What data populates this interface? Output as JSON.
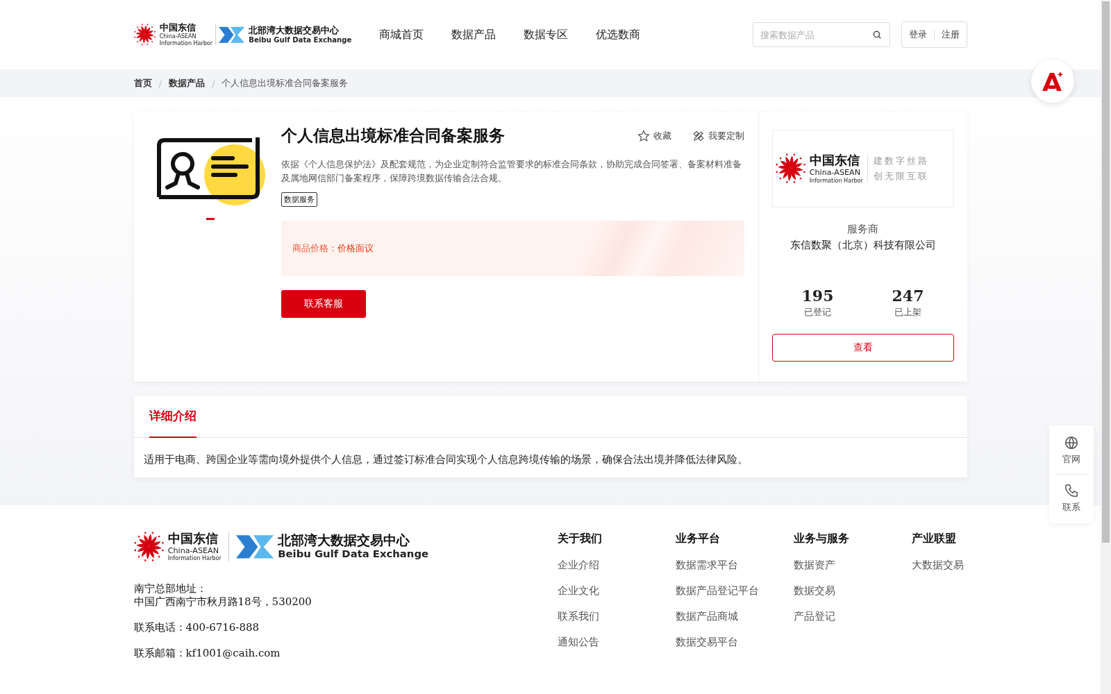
{
  "header": {
    "logo_cn": {
      "name": "中国东信",
      "en1": "China-ASEAN",
      "en2": "Information Harbor"
    },
    "logo_bb": {
      "name": "北部湾大数据交易中心",
      "en": "Beibu Gulf Data Exchange"
    },
    "nav": [
      {
        "label": "商城首页",
        "selected": false
      },
      {
        "label": "数据产品",
        "selected": false
      },
      {
        "label": "数据专区",
        "selected": false
      },
      {
        "label": "优选数商",
        "selected": false
      }
    ],
    "search": {
      "placeholder": "搜索数据产品"
    },
    "login": "登录",
    "register": "注册"
  },
  "breadcrumb_separator": "/",
  "breadcrumb": [
    {
      "label": "首页"
    },
    {
      "label": "数据产品"
    },
    {
      "label": "个人信息出境标准合同备案服务"
    }
  ],
  "product": {
    "title": "个人信息出境标准合同备案服务",
    "favorite": "收藏",
    "customize": "我要定制",
    "description": "依据《个人信息保护法》及配套规范，为企业定制符合监管要求的标准合同条款，协助完成合同签署、备案材料准备及属地网信部门备案程序，保障跨境数据传输合法合规。",
    "tags": [
      "数据服务"
    ],
    "price_label": "商品价格：",
    "price_value": "价格面议",
    "contact_button": "联系客服"
  },
  "provider": {
    "logo": {
      "name": "中国东信",
      "en1": "China-ASEAN",
      "en2": "Information Harbor",
      "slogan1": "建数字丝路",
      "slogan2": "创无限互联"
    },
    "role": "服务商",
    "name": "东信数聚（北京）科技有限公司",
    "stats": [
      {
        "value": "195",
        "label": "已登记"
      },
      {
        "value": "247",
        "label": "已上架"
      }
    ],
    "view_button": "查看"
  },
  "details": {
    "tabs": [
      {
        "label": "详细介绍",
        "selected": true
      }
    ],
    "text": "适用于电商、跨国企业等需向境外提供个人信息，通过签订标准合同实现个人信息跨境传输的场景，确保合法出境并降低法律风险。"
  },
  "side_tools": [
    {
      "kind": "globe",
      "label": "官网"
    },
    {
      "kind": "phone",
      "label": "联系"
    }
  ],
  "footer": {
    "logo_cn": {
      "name": "中国东信",
      "en1": "China-ASEAN",
      "en2": "Information Harbor"
    },
    "logo_bb": {
      "name": "北部湾大数据交易中心",
      "en": "Beibu Gulf Data Exchange"
    },
    "address_label": "南宁总部地址：",
    "address": "中国广西南宁市秋月路18号，530200",
    "phone": "联系电话：400-6716-888",
    "email": "联系邮箱：kf1001@caih.com",
    "columns": [
      {
        "title": "关于我们",
        "links": [
          "企业介绍",
          "企业文化",
          "联系我们",
          "通知公告"
        ]
      },
      {
        "title": "业务平台",
        "links": [
          "数据需求平台",
          "数据产品登记平台",
          "数据产品商城",
          "数据交易平台"
        ]
      },
      {
        "title": "业务与服务",
        "links": [
          "数据资产",
          "数据交易",
          "产品登记"
        ]
      },
      {
        "title": "产业联盟",
        "links": [
          "大数据交易"
        ]
      }
    ]
  }
}
